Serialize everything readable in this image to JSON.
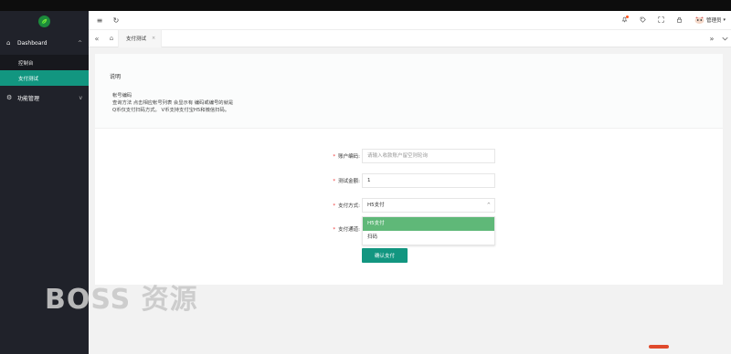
{
  "sidebar": {
    "logo_icon": "leaf-logo",
    "groups": [
      {
        "icon": "home-icon",
        "label": "Dashboard",
        "chevron": "^",
        "items": [
          {
            "label": "控制台"
          },
          {
            "label": "支付测试"
          }
        ]
      },
      {
        "icon": "gear-icon",
        "label": "功能管理",
        "chevron": "v"
      }
    ]
  },
  "header": {
    "menu_icon": "≡",
    "refresh_icon": "↻",
    "user": {
      "name": "管理员",
      "caret": "▾"
    }
  },
  "tabs": {
    "active": {
      "label": "支付测试",
      "close": "×"
    }
  },
  "notice": {
    "title": "说明",
    "lines": [
      "帐号编码",
      "查询方法 点击相应帐号列表 会显示有 编码或编号的就是",
      "Q币仅支付扫码方式。 V币支持支付宝H5和微信扫码。"
    ]
  },
  "form": {
    "account": {
      "label": "账户编码:",
      "placeholder": "请输入收款账户留空则轮询"
    },
    "amount": {
      "label": "测试金额:",
      "value": "1"
    },
    "paytype": {
      "label": "支付方式:",
      "value": "H5支付",
      "caret": "^"
    },
    "channel": {
      "label": "支付通道:"
    },
    "options": [
      "H5支付",
      "扫码"
    ],
    "submit": "确认支付"
  },
  "watermark": "BOSS 资源",
  "colors": {
    "accent": "#129680",
    "sidebar": "#20222a",
    "selected_option": "#5fb878"
  }
}
